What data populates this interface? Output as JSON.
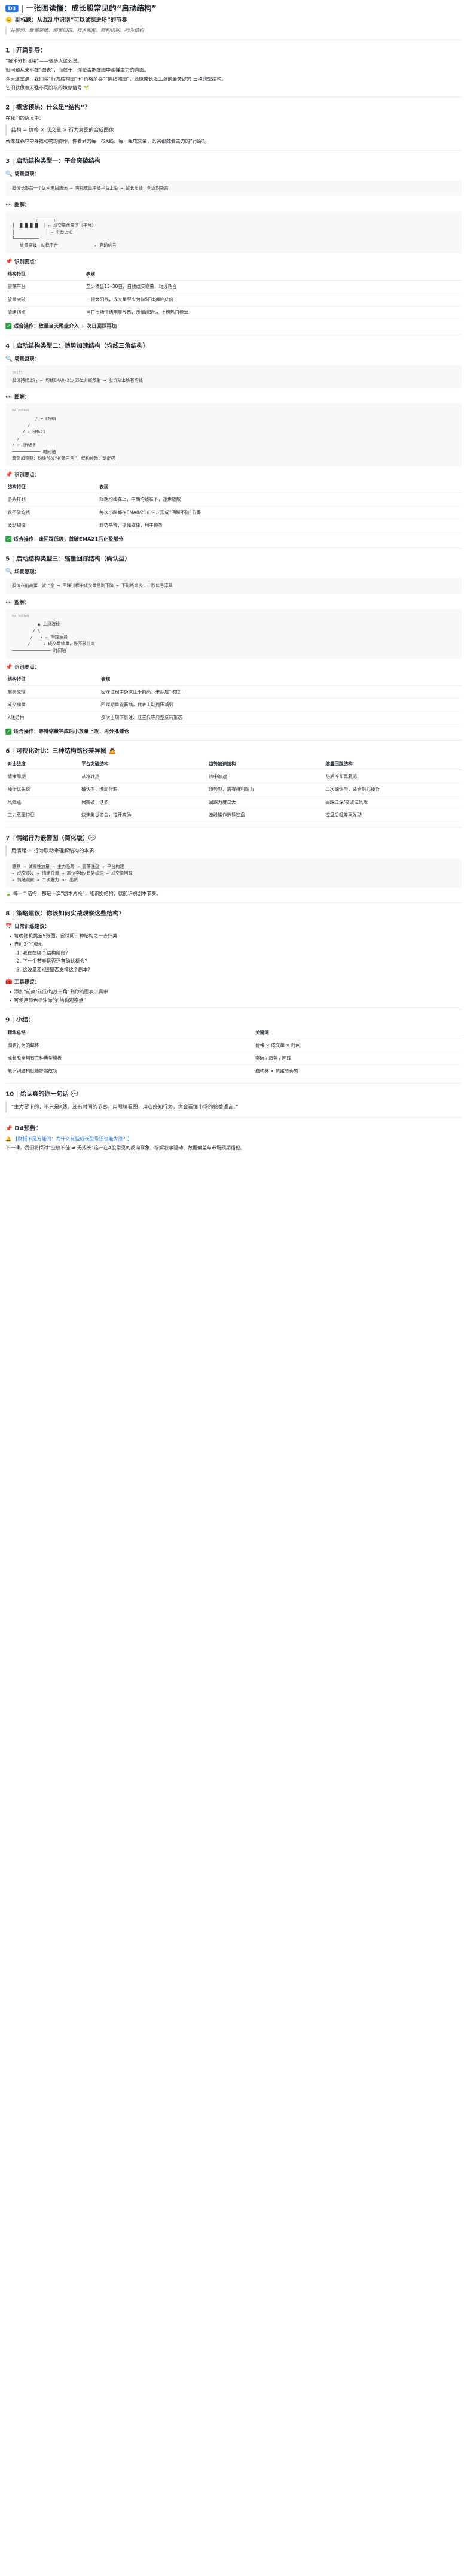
{
  "header": {
    "badge": "D3",
    "title": "| 一张图读懂：成长股常见的“启动结构”",
    "subtitle_icon": "🙂",
    "subtitle": "副标题：从混乱中识别“可以试探进场”的节奏",
    "keywords": "关键词：放量突破、缩量回踩、技术图形、结构识别、行为结构"
  },
  "s1": {
    "title": "1 | 开篇引导：",
    "p1": "“技术分析没用”——很多人这么说。",
    "p2": "但问题从来不在“图表”，而在于：你是否能在图中读懂主力的意图。",
    "p3": "今天这堂课，我们带“行为结构图”+“价格节奏”“情绪地图”，还原成长股上涨前最关键的 三种典型结构。",
    "p4": "它们就像春天强不同阶段的嫩芽信号 🌱"
  },
  "s2": {
    "title": "2 | 概念预热：什么是“结构”？",
    "p1": "在我们的语境中：",
    "quote": "结构 = 价格 × 成交量 × 行为意图的合成图像",
    "p2": "就像在森林中寻找动物的脚印，你看到的每一根K线、每一组成交量，其实都藏着主力的“行踪”。"
  },
  "s3": {
    "title": "3 | 启动结构类型一：平台突破结构",
    "scene_title": "场景复现：",
    "scene": "股价长期在一个区间来回震荡 → 突然放量冲破平台上沿 → 留长阳线，创近期新高",
    "chart_title": "图解：",
    "chart": "         ┌──────┐\n│  █ █ █ █  │ ← 成交量放量区（平台）\n│            │ ← 平台上沿\n└─────────┘\n   放量突破，站稳平台              ↗ 启动信号",
    "points_title": "识别要点：",
    "table_headers": [
      "结构特征",
      "表现"
    ],
    "rows": [
      [
        "震荡平台",
        "至少横盘15–30日，日线成交缩量，均线粘合"
      ],
      [
        "放量突破",
        "一根大阳线，成交量至少为前5日均量的2倍"
      ],
      [
        "情绪拐点",
        "当日市场情绪明显放热，涨幅超5%，上榜热门榜单"
      ]
    ],
    "tip": "适合操作：放量当天尾盘介入 + 次日回踩再加"
  },
  "s4": {
    "title": "4 | 启动结构类型二：趋势加速结构（均线三角结构）",
    "scene_title": "场景复现：",
    "scene_lang": "swift",
    "scene": "股价持续上行 → 均线EMA8/21/55呈开线散射 → 股价站上所有均线",
    "chart_title": "图解：",
    "chart_lang": "markdown",
    "chart": "         / ← EMA8\n      /\n    / ← EMA21\n  /\n/ ← EMA55\n─────────── 时间轴\n趋势加速期：均线形成“扩散三角”，结构放散、动能强",
    "points_title": "识别要点：",
    "table_headers": [
      "结构特征",
      "表现"
    ],
    "rows": [
      [
        "多头排列",
        "短期均线在上，中期均线在下，逐步放散"
      ],
      [
        "跌不破均线",
        "每次小跌都在EMA8/21止住，形成“回踩不破”节奏"
      ],
      [
        "波动规律",
        "趋势平滑，振幅规律，利于持盈"
      ]
    ],
    "tip": "适合操作：逢回踩低吸，首破EMA21后止盈部分"
  },
  "s5": {
    "title": "5 | 启动结构类型三：缩量回踩结构（确认型）",
    "scene_title": "场景复现：",
    "scene": "股价在前高第一波上涨 → 回踩过程中成交量急剧下降 → 下影线增多，止跌信号浮现",
    "chart_title": "图解：",
    "chart_lang": "markdown",
    "chart": "          ▲ 上涨波段\n        / \\\n       /   \\ ← 回踩波段\n      /     ↓ 成交量缩量，跌不破前高\n─────────────── 时间轴",
    "points_title": "识别要点：",
    "table_headers": [
      "结构特征",
      "表现"
    ],
    "rows": [
      [
        "前高支撑",
        "回踩过程中多次止于前高，未形成“破位”"
      ],
      [
        "成交缩量",
        "回踩期量能萎缩，代表主动抛压减弱"
      ],
      [
        "K线结构",
        "多次出现下影线、红三兵等典型反转形态"
      ]
    ],
    "tip": "适合操作：等待缩量完成后小放量上攻，再分批建仓"
  },
  "s6": {
    "title": "6 | 可视化对比：三种结构路径差异图 🙇",
    "headers": [
      "对比维度",
      "平台突破结构",
      "趋势加速结构",
      "缩量回踩结构"
    ],
    "rows": [
      [
        "情绪周期",
        "从冷转热",
        "热中加速",
        "热后冷却再复苏"
      ],
      [
        "操作优先级",
        "确认型，慢动作跟",
        "趋势型，需有持利耐力",
        "二次确认型，适合耐心操作"
      ],
      [
        "风险点",
        "假突破，诱多",
        "回踩力度过大",
        "回踩过深/被破位风险"
      ],
      [
        "主力意图特征",
        "快速聚拢资金，拉开筹码",
        "波段操作选择控盘",
        "控盘后吸筹再发动"
      ]
    ]
  },
  "s7": {
    "title": "7 | 情绪行为嵌套图（简化版）💬",
    "quote": "用情绪 + 行为联动来理解结构的本质",
    "chart": "静默 → 试探性放量 → 主力吸筹 → 震荡洗盘 → 平台构建\n→ 成交爆发 → 情绪升温 → 高位突破/趋势加速 → 成交量回踩\n→ 情绪观察 → 二次发力 or 出货",
    "p": "🍃 每一个结构，都是一次“剧本片段”，能识别结构，就能识别剧本节奏。"
  },
  "s8": {
    "title": "8 | 策略建议：你该如何实战观察这些结构？",
    "training_title": "日常训练建议：",
    "training": [
      "每晚随机挑选5张图，尝试问三种结构之一去归类",
      "自问3个问题："
    ],
    "questions": [
      "我在在哪个结构阶段？",
      "下一个节奏是否还有确认机会？",
      "这波量和K线是否支撑这个剧本？"
    ],
    "tools_title": "工具建议：",
    "tools": [
      "添加“前高/前低/均线三角”到你的图表工具中",
      "可使用颜色标注你的“结构观察点”"
    ]
  },
  "s9": {
    "title": "9 | 小结：",
    "headers": [
      "精华总结",
      "关键词"
    ],
    "rows": [
      [
        "图表行为的整体",
        "价格 × 成交量 × 时间"
      ],
      [
        "成长股常用有三种典型模板",
        "突破 / 趋势 / 回踩"
      ],
      [
        "能识别结构就能提高成功",
        "结构感 × 情绪节奏感"
      ]
    ]
  },
  "s10": {
    "title": "10 | 给认真的你一句话 💬",
    "quote": "“主力留下的，不只是K线，还有时间的节奏。用眼睛看图，用心感知行为，你会看懂市场的轮番语言。”"
  },
  "d4": {
    "title": "D4预告：",
    "lead": "🔔 【财报不是万能的：为什么有些成长股号拐也能大涨？】",
    "text": "下一课，我们将探讨“业绩不佳 ≠ 无成长”这一在A股常见的反向现象，拆解叙事驱动、数据偏差与市场预期错位。"
  }
}
